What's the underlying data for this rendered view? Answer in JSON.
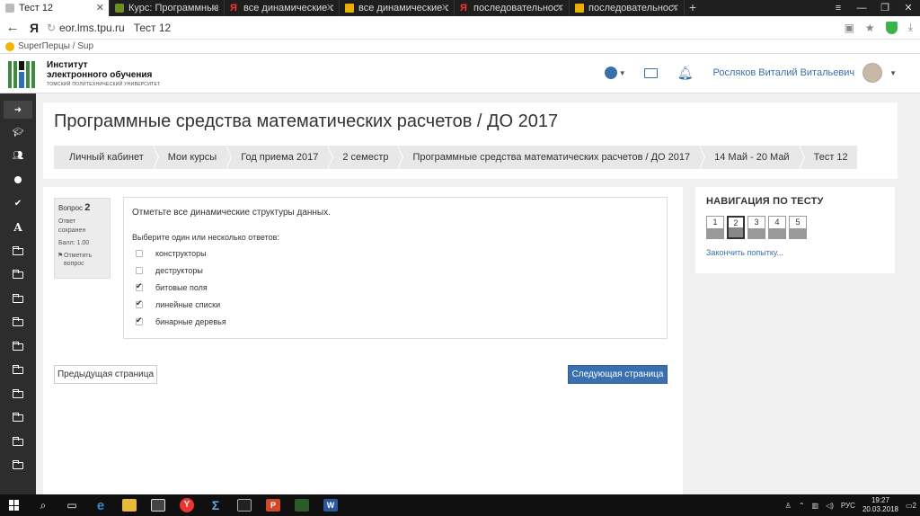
{
  "browser": {
    "tabs": [
      {
        "label": "Тест 12",
        "active": true
      },
      {
        "label": "Курс: Программные средства",
        "active": false
      },
      {
        "label": "все динамические структуры",
        "active": false
      },
      {
        "label": "все динамические структуры",
        "active": false
      },
      {
        "label": "последовательность выполн",
        "active": false
      },
      {
        "label": "последовательность выполн",
        "active": false
      }
    ],
    "new_tab": "+",
    "url": "eor.lms.tpu.ru",
    "page_title": "Тест 12",
    "ya": "Я",
    "bookmark": "SuperПерцы / Sup"
  },
  "header": {
    "logo_line1": "Институт",
    "logo_line2": "электронного обучения",
    "logo_sub": "ТОМСКИЙ ПОЛИТЕХНИЧЕСКИЙ УНИВЕРСИТЕТ",
    "user_name": "Росляков Виталий Витальевич"
  },
  "course": {
    "title": "Программные средства математических расчетов / ДО 2017",
    "breadcrumb": [
      "Личный кабинет",
      "Мои курсы",
      "Год приема 2017",
      "2 семестр",
      "Программные средства математических расчетов / ДО 2017",
      "14 Май - 20 Май",
      "Тест 12"
    ]
  },
  "question": {
    "label": "Вопрос",
    "number": "2",
    "state_line1": "Ответ",
    "state_line2": "сохранен",
    "grade": "Балл: 1.00",
    "flag_line1": "Отметить",
    "flag_line2": "вопрос",
    "text": "Отметьте все динамические структуры данных.",
    "prompt": "Выберите один или несколько ответов:",
    "answers": [
      {
        "label": "конструкторы",
        "checked": false
      },
      {
        "label": "деструкторы",
        "checked": false
      },
      {
        "label": "битовые поля",
        "checked": true
      },
      {
        "label": "линейные списки",
        "checked": true
      },
      {
        "label": "бинарные деревья",
        "checked": true
      }
    ]
  },
  "buttons": {
    "prev": "Предыдущая страница",
    "next": "Следующая страница"
  },
  "navigation": {
    "title": "НАВИГАЦИЯ ПО ТЕСТУ",
    "questions": [
      "1",
      "2",
      "3",
      "4",
      "5"
    ],
    "current": "2",
    "finish": "Закончить попытку..."
  },
  "taskbar": {
    "lang": "РУС",
    "time": "19:27",
    "date": "20.03.2018",
    "notifications": "2"
  },
  "colors": {
    "primary": "#3a70b0",
    "sidebar": "#2d2d2d",
    "taskbar": "#101010"
  }
}
